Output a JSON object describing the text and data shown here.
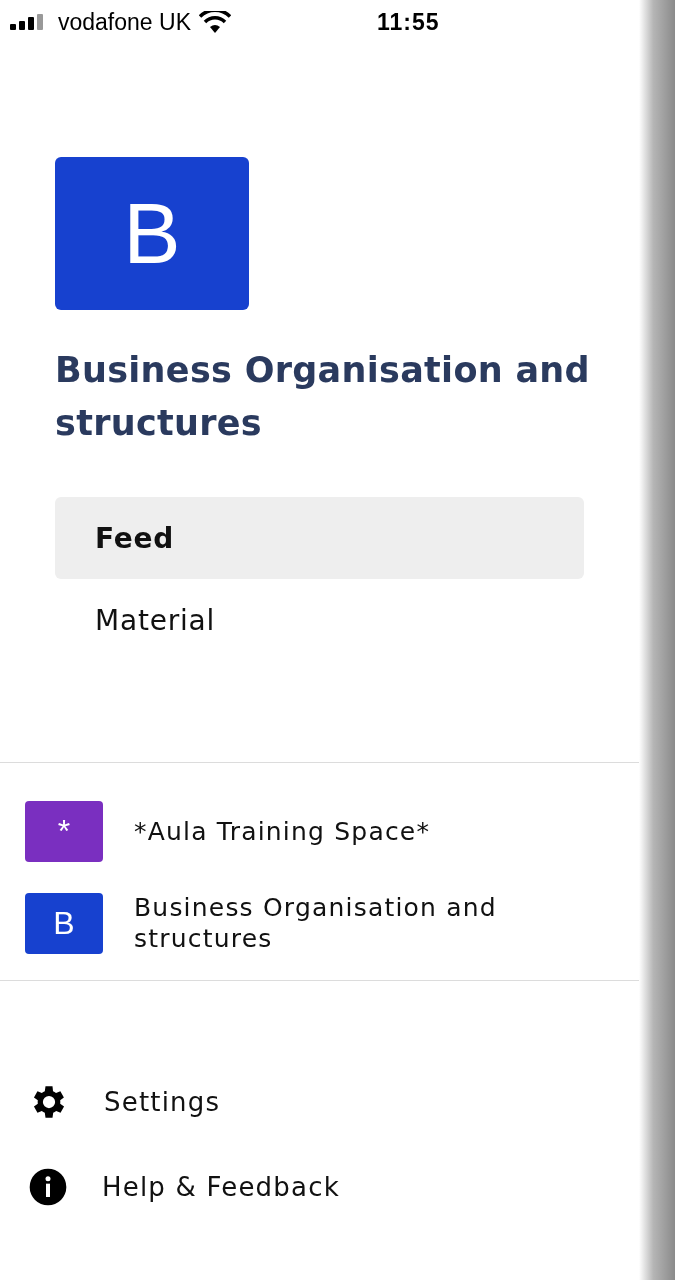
{
  "status_bar": {
    "carrier": "vodafone UK",
    "time": "11:55"
  },
  "course": {
    "logo_letter": "B",
    "title": "Business Organisation and structures"
  },
  "nav": [
    {
      "label": "Feed",
      "selected": true
    },
    {
      "label": "Material",
      "selected": false
    }
  ],
  "spaces": [
    {
      "letter": "*",
      "color": "#7a2fc0",
      "name": "*Aula Training Space*"
    },
    {
      "letter": "B",
      "color": "#1741cf",
      "name": "Business Organisation and structures"
    }
  ],
  "footer_links": [
    {
      "kind": "settings",
      "label": "Settings"
    },
    {
      "kind": "help",
      "label": "Help & Feedback"
    }
  ]
}
